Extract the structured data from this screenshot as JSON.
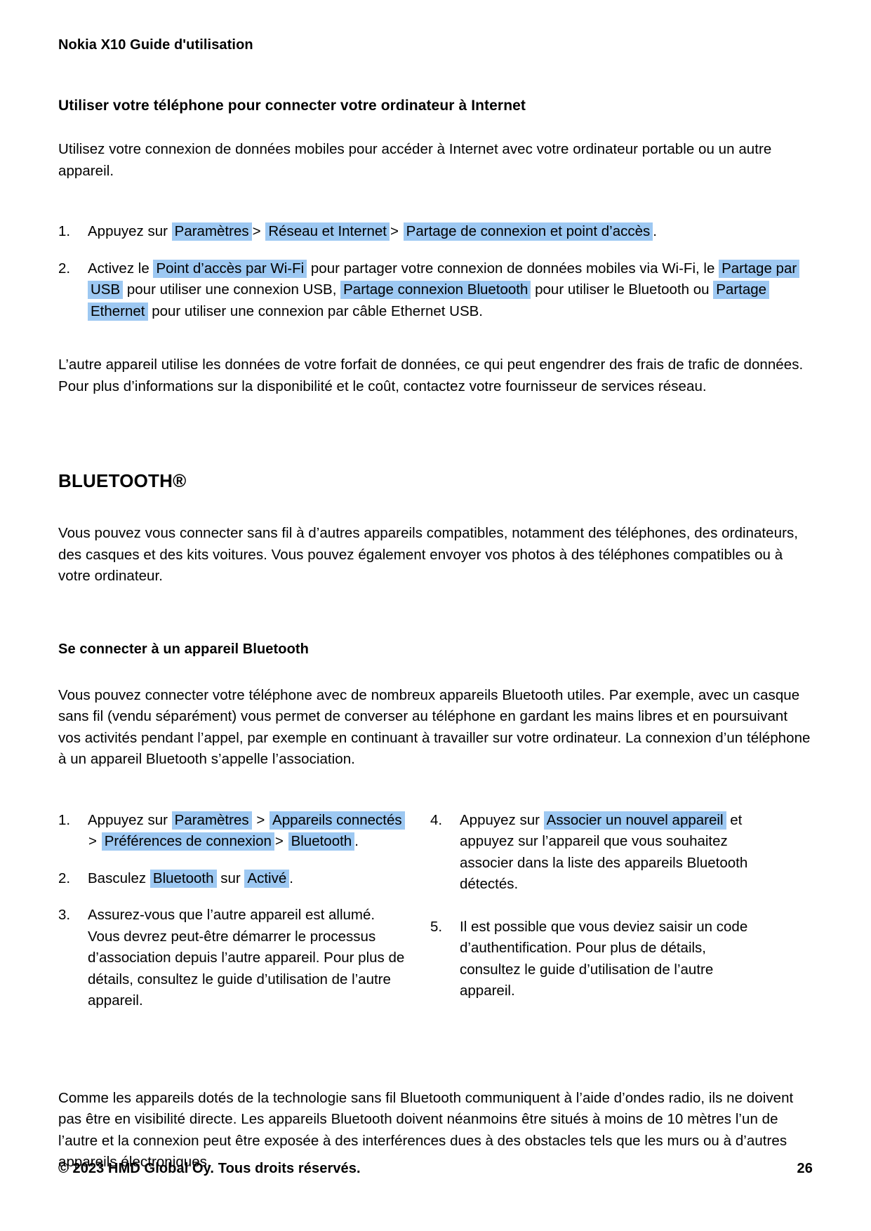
{
  "header": {
    "running_title": "Nokia X10 Guide d'utilisation"
  },
  "tethering_section": {
    "title": "Utiliser votre téléphone pour connecter votre ordinateur à Internet",
    "intro": "Utilisez votre connexion de données mobiles pour accéder à Internet avec votre ordinateur portable ou un autre appareil.",
    "steps": [
      {
        "num": "1.",
        "lead": "Appuyez sur",
        "t1": "Paramètres",
        "sep1": ">",
        "t2": "Réseau et Internet",
        "sep2": ">",
        "t3": "Partage de connexion et point d’accès",
        "tail": "."
      },
      {
        "num": "2.",
        "lead": "Activez le",
        "t1": "Point d’accès par Wi-Fi",
        "mid1": "pour partager votre connexion de données mobiles via Wi-Fi, le",
        "t2": "Partage par USB",
        "mid2": "pour utiliser une connexion USB,",
        "t3": "Partage connexion Bluetooth",
        "mid3": "pour utiliser le Bluetooth ou",
        "t4": "Partage Ethernet",
        "tail": "pour utiliser une connexion par câble Ethernet USB."
      }
    ],
    "outro": "L’autre appareil utilise les données de votre forfait de données, ce qui peut engendrer des frais de trafic de données. Pour plus d’informations sur la disponibilité et le coût, contactez votre fournisseur de services réseau."
  },
  "bluetooth_section": {
    "title": "BLUETOOTH®",
    "intro": "Vous pouvez vous connecter sans fil à d’autres appareils compatibles, notamment des téléphones, des ordinateurs, des casques et des kits voitures. Vous pouvez également envoyer vos photos à des téléphones compatibles ou à votre ordinateur.",
    "subsection": {
      "title": "Se connecter à un appareil Bluetooth",
      "intro": "Vous pouvez connecter votre téléphone avec de nombreux appareils Bluetooth utiles. Par exemple, avec un casque sans fil (vendu séparément) vous permet de converser au téléphone en gardant les mains libres et en poursuivant vos activités pendant l’appel, par exemple en continuant à travailler sur votre ordinateur. La connexion d’un téléphone à un appareil Bluetooth s’appelle l’association.",
      "steps_left": [
        {
          "num": "1.",
          "lead": "Appuyez sur",
          "t1": "Paramètres",
          "sep1": ">",
          "t2": "Appareils connectés",
          "sep2": ">",
          "t3": "Préférences de connexion",
          "sep3": ">",
          "t4": "Bluetooth",
          "tail": "."
        },
        {
          "num": "2.",
          "lead": "Basculez",
          "t1": "Bluetooth",
          "mid1": "sur",
          "t2": "Activé",
          "tail": "."
        },
        {
          "num": "3.",
          "text": "Assurez-vous que l’autre appareil est allumé. Vous devrez peut-être démarrer le processus d’association depuis l’autre appareil. Pour plus de détails, consultez le guide d’utilisation de l’autre appareil."
        }
      ],
      "steps_right": [
        {
          "num": "4.",
          "lead": "Appuyez sur",
          "t1": "Associer un nouvel appareil",
          "tail": "et appuyez sur l’appareil que vous souhaitez associer dans la liste des appareils Bluetooth détectés."
        },
        {
          "num": "5.",
          "text": "Il est possible que vous deviez saisir un code d’authentification. Pour plus de détails, consultez le guide d’utilisation de l’autre appareil."
        }
      ],
      "outro": "Comme les appareils dotés de la technologie sans fil Bluetooth communiquent à l’aide d’ondes radio, ils ne doivent pas être en visibilité directe. Les appareils Bluetooth doivent néanmoins être situés à moins de 10 mètres l’un de l’autre et la connexion peut être exposée à des interférences dues à des obstacles tels que les murs ou à d’autres appareils électroniques."
    }
  },
  "footer": {
    "copyright": "© 2023 HMD Global Oy. Tous droits réservés.",
    "page_number": "26"
  },
  "colors": {
    "highlight": "#9dc8f2",
    "text": "#000000",
    "background": "#ffffff"
  }
}
